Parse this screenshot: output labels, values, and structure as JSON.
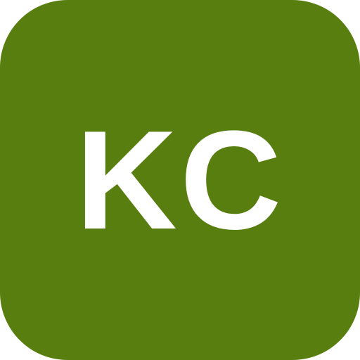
{
  "avatar": {
    "initials": "KC",
    "background_color": "#577e0f",
    "text_color": "#ffffff"
  }
}
